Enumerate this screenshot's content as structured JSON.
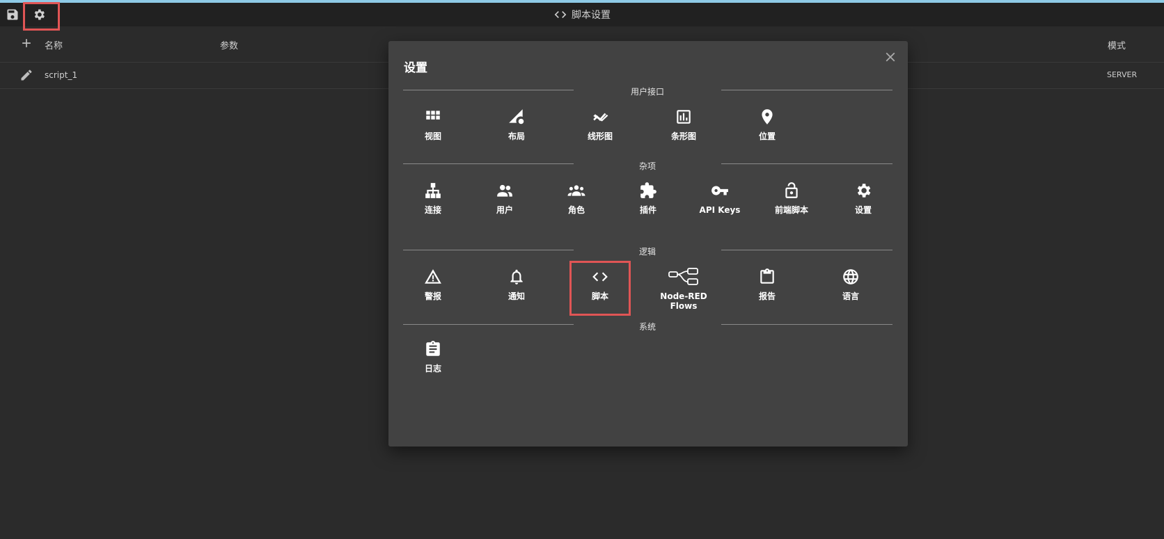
{
  "header": {
    "title": "脚本设置",
    "save_icon": "save-icon",
    "settings_icon": "gear-icon"
  },
  "table": {
    "columns": [
      "名称",
      "参数",
      "模式"
    ],
    "rows": [
      {
        "name": "script_1",
        "mode": "SERVER"
      }
    ]
  },
  "dialog": {
    "title": "设置",
    "sections": {
      "ui": "用户接口",
      "misc": "杂项",
      "logic": "逻辑",
      "system": "系统"
    },
    "ui_items": [
      "视图",
      "布局",
      "线形图",
      "条形图",
      "位置"
    ],
    "misc_items": [
      "连接",
      "用户",
      "角色",
      "插件",
      "API Keys",
      "前端脚本",
      "设置"
    ],
    "logic_items": [
      "警报",
      "通知",
      "脚本",
      "Node-RED Flows",
      "报告",
      "语言"
    ],
    "system_items": [
      "日志"
    ]
  },
  "colors": {
    "background": "#2b2b2b",
    "dialog": "#424242",
    "highlight": "#e05555",
    "top_strip": "#8ecae6"
  }
}
